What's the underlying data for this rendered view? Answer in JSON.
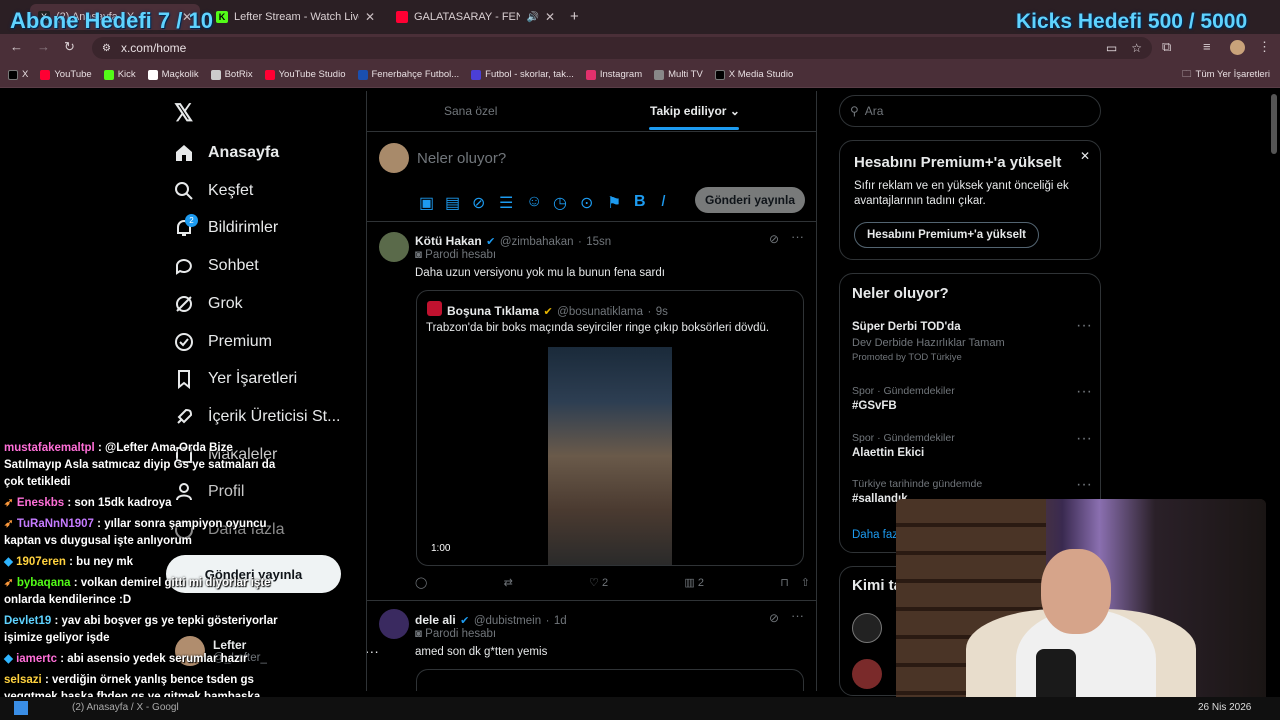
{
  "overlay": {
    "left": "Abone Hedefi 7 / 10",
    "right": "Kicks Hedefi 500 / 5000"
  },
  "tabs": [
    {
      "title": "(2) Anasayfa / X",
      "color": "#222222"
    },
    {
      "title": "Lefter Stream - Watch Live on Kick",
      "color": "#53fc18"
    },
    {
      "title": "GALATASARAY - FENERBAHÇE",
      "color": "#ff0033"
    }
  ],
  "url": "x.com/home",
  "bookmarks": [
    {
      "label": "X",
      "color": "#000000"
    },
    {
      "label": "YouTube",
      "color": "#ff0033"
    },
    {
      "label": "Kick",
      "color": "#53fc18"
    },
    {
      "label": "Maçkolik",
      "color": "#ffffff"
    },
    {
      "label": "BotRix",
      "color": "#cccccc"
    },
    {
      "label": "YouTube Studio",
      "color": "#ff0033"
    },
    {
      "label": "Fenerbahçe Futbol...",
      "color": "#1a4fb0"
    },
    {
      "label": "Futbol - skorlar, tak...",
      "color": "#4b3fd6"
    },
    {
      "label": "Instagram",
      "color": "#e1306c"
    },
    {
      "label": "Multi TV",
      "color": "#888888"
    },
    {
      "label": "X Media Studio",
      "color": "#000000"
    }
  ],
  "bookmarks_folder": "Tüm Yer İşaretleri",
  "nav": {
    "home": "Anasayfa",
    "explore": "Keşfet",
    "notifications": "Bildirimler",
    "notif_count": "2",
    "chat": "Sohbet",
    "grok": "Grok",
    "premium": "Premium",
    "bookmarks": "Yer İşaretleri",
    "creator": "İçerik Üreticisi St...",
    "articles": "Makaleler",
    "profile": "Profil",
    "more": "Daha fazla",
    "post_button": "Gönderi yayınla",
    "account_name": "Lefter",
    "account_handle": "@_Lefter_"
  },
  "timeline": {
    "tab_foryou": "Sana özel",
    "tab_following": "Takip ediliyor",
    "compose_placeholder": "Neler oluyor?",
    "compose_button": "Gönderi yayınla"
  },
  "tweets": [
    {
      "name": "Kötü Hakan",
      "handle": "@zimbahakan",
      "time": "15sn",
      "label": "Parodi hesabı",
      "text": "Daha uzun versiyonu yok mu la bunun fena sardı",
      "quote": {
        "name": "Boşuna Tıklama",
        "handle": "@bosunatiklama",
        "time": "9s",
        "text": "Trabzon'da bir boks maçında seyirciler ringe çıkıp boksörleri dövdü.",
        "duration": "1:00"
      },
      "likes": "2",
      "views": "2"
    },
    {
      "name": "dele ali",
      "handle": "@dubistmein",
      "time": "1d",
      "label": "Parodi hesabı",
      "text": "amed son dk g*tten yemis"
    }
  ],
  "search": {
    "placeholder": "Ara"
  },
  "premium_card": {
    "title": "Hesabını Premium+'a yükselt",
    "body": "Sıfır reklam ve en yüksek yanıt önceliği ek avantajlarının tadını çıkar.",
    "button": "Hesabını Premium+'a yükselt"
  },
  "trends": {
    "title": "Neler oluyor?",
    "items": [
      {
        "meta": "",
        "title": "Süper Derbi TOD'da",
        "sub": "Dev Derbide Hazırlıklar Tamam",
        "promo": "Promoted by TOD Türkiye"
      },
      {
        "meta": "Spor · Gündemdekiler",
        "title": "#GSvFB"
      },
      {
        "meta": "Spor · Gündemdekiler",
        "title": "Alaettin Ekici"
      },
      {
        "meta": "Türkiye tarihinde gündemde",
        "title": "#sallandık"
      }
    ],
    "show_more": "Daha fazla"
  },
  "who_to_follow": {
    "title": "Kimi takip etmeli"
  },
  "chat": [
    {
      "user": "mustafakemaltpl",
      "color": "#ff6fd8",
      "text": ": @Lefter Ama Orda Bize Satılmayıp Asla satmıcaz diyip Gs ye satmaları da çok tetikledi"
    },
    {
      "user": "Eneskbs",
      "color": "#ff6fd8",
      "text": ": son 15dk kadroya"
    },
    {
      "user": "TuRaNnN1907",
      "color": "#c57bff",
      "text": ": yıllar sonra şampiyon oyuncu kaptan vs duygusal işte anlıyorum"
    },
    {
      "user": "1907eren",
      "color": "#ffd23f",
      "text": ": bu ney mk"
    },
    {
      "user": "bybaqana",
      "color": "#53fc18",
      "text": ": volkan demirel gitti mi diyorlar işte onlarda kendilerince :D"
    },
    {
      "user": "Devlet19",
      "color": "#5fd3ff",
      "text": ": yav abi boşver gs ye tepki gösteriyorlar işimize geliyor işde"
    },
    {
      "user": "iamertc",
      "color": "#ff6fd8",
      "text": ": abi asensio yedek serumlar hazır"
    },
    {
      "user": "selsazi",
      "color": "#ffd23f",
      "text": ": verdiğin örnek yanlış bence tsden gs yeggtmek başka fbden gs ye gitmek bambaşka"
    }
  ],
  "taskbar": {
    "window": "(2) Anasayfa / X - Googl",
    "date": "26 Nis 2026"
  }
}
